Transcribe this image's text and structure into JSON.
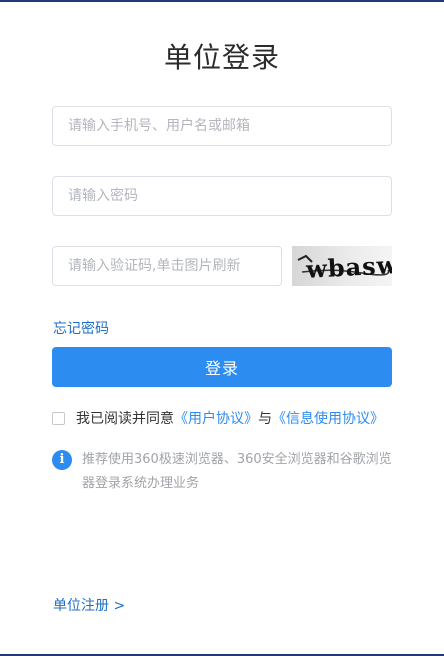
{
  "title": "单位登录",
  "form": {
    "account_placeholder": "请输入手机号、用户名或邮箱",
    "password_placeholder": "请输入密码",
    "captcha_placeholder": "请输入验证码,单击图片刷新",
    "captcha_text": "wbasw"
  },
  "forgot_password": "忘记密码",
  "login_button": "登录",
  "agreement": {
    "prefix": "我已阅读并同意",
    "user_agreement": "《用户协议》",
    "conjunction": "与",
    "info_agreement": "《信息使用协议》"
  },
  "notice": {
    "icon": "i",
    "text": "推荐使用360极速浏览器、360安全浏览器和谷歌浏览器登录系统办理业务"
  },
  "register_link": "单位注册 >"
}
